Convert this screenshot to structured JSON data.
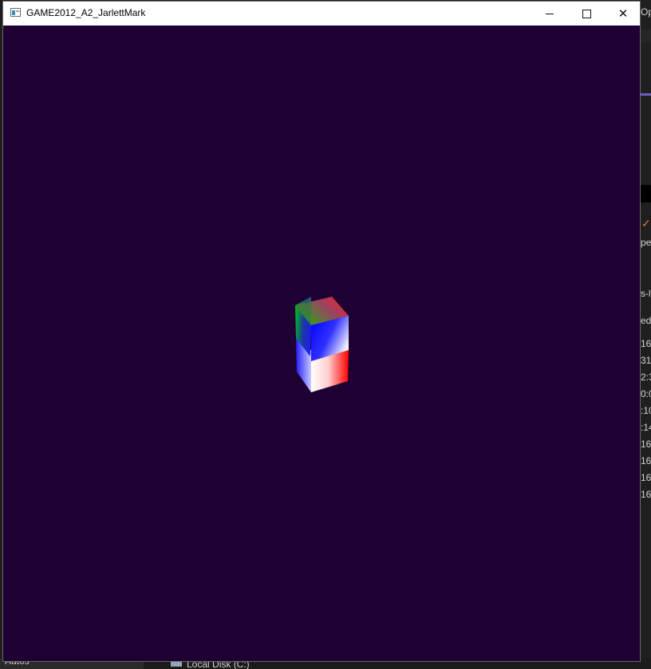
{
  "window": {
    "title": "GAME2012_A2_JarlettMark",
    "minimize_label": "—",
    "close_label": "✕",
    "background_color": "#1f0033"
  },
  "background_fragments": {
    "right_top": "Ope",
    "right_items": [
      "pe",
      "s-l",
      "ed",
      "16",
      "31",
      "2:3",
      "0:0",
      ":10",
      ":14",
      "16",
      "16",
      "16",
      "16"
    ],
    "bottom_left": "Autos",
    "bottom_drive": "Local Disk (C:)"
  },
  "scene": {
    "object": "two stacked color-gradient cubes",
    "colors": {
      "red": "#ff0000",
      "green": "#00cc00",
      "blue": "#0000ff",
      "white": "#ffffff"
    }
  }
}
